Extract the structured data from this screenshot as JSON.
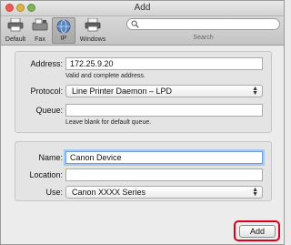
{
  "window": {
    "title": "Add"
  },
  "toolbar": {
    "buttons": [
      {
        "label": "Default",
        "icon": "printer-icon"
      },
      {
        "label": "Fax",
        "icon": "fax-icon"
      },
      {
        "label": "IP",
        "icon": "globe-icon"
      },
      {
        "label": "Windows",
        "icon": "windows-printer-icon"
      }
    ],
    "search": {
      "label": "Search",
      "value": ""
    }
  },
  "connection": {
    "address_label": "Address:",
    "address_value": "172.25.9.20",
    "address_hint": "Valid and complete address.",
    "protocol_label": "Protocol:",
    "protocol_value": "Line Printer Daemon – LPD",
    "queue_label": "Queue:",
    "queue_value": "",
    "queue_hint": "Leave blank for default queue."
  },
  "printer": {
    "name_label": "Name:",
    "name_value": "Canon Device",
    "location_label": "Location:",
    "location_value": "",
    "use_label": "Use:",
    "use_value": "Canon XXXX Series"
  },
  "footer": {
    "add_label": "Add"
  },
  "colors": {
    "highlight": "#d8001c",
    "focus_ring": "#a8c8ec"
  }
}
